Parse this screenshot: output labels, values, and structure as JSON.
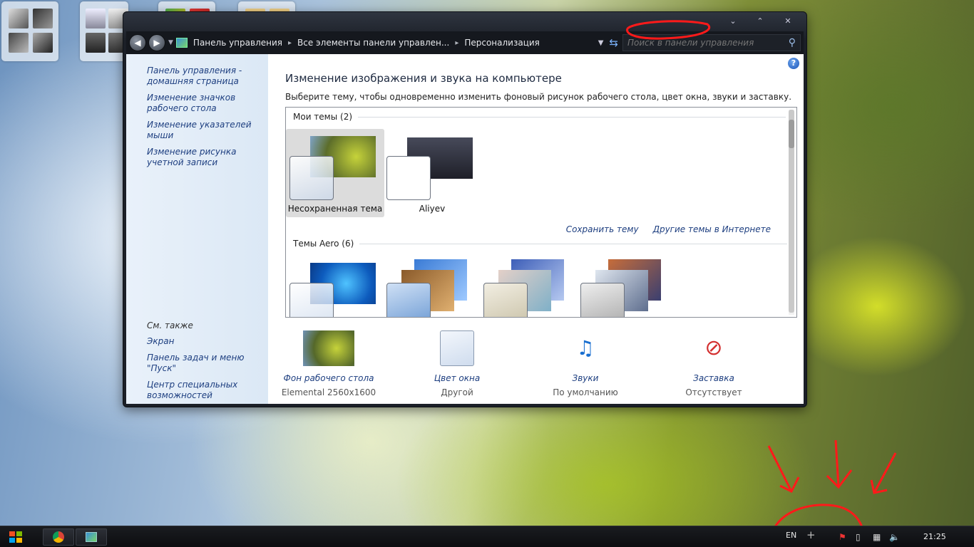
{
  "window": {
    "caption_buttons": [
      "⌄",
      "⌃",
      "✕"
    ],
    "breadcrumbs": [
      "Панель управления",
      "Все элементы панели управлен...",
      "Персонализация"
    ],
    "search_placeholder": "Поиск в панели управления"
  },
  "sidebar": {
    "links": [
      "Панель управления - домашняя страница",
      "Изменение значков рабочего стола",
      "Изменение указателей мыши",
      "Изменение рисунка учетной записи"
    ],
    "see_also_title": "См. также",
    "see_also": [
      "Экран",
      "Панель задач и меню \"Пуск\"",
      "Центр специальных возможностей"
    ]
  },
  "main": {
    "help_label": "?",
    "title": "Изменение изображения и звука на компьютере",
    "description": "Выберите тему, чтобы одновременно изменить фоновый рисунок рабочего стола, цвет окна, звуки и заставку.",
    "my_themes_header": "Мои темы (2)",
    "my_themes": [
      "Несохраненная тема",
      "Aliyev"
    ],
    "save_theme": "Сохранить тему",
    "more_themes": "Другие темы в Интернете",
    "aero_header": "Темы Aero (6)",
    "bottom": [
      {
        "label": "Фон рабочего стола",
        "value": "Elemental 2560x1600"
      },
      {
        "label": "Цвет окна",
        "value": "Другой"
      },
      {
        "label": "Звуки",
        "value": "По умолчанию"
      },
      {
        "label": "Заставка",
        "value": "Отсутствует"
      }
    ]
  },
  "taskbar": {
    "language": "EN",
    "plus": "+",
    "time": "21:25"
  },
  "colors": {
    "link": "#1e3f80",
    "annotation": "#ff1a1a"
  }
}
